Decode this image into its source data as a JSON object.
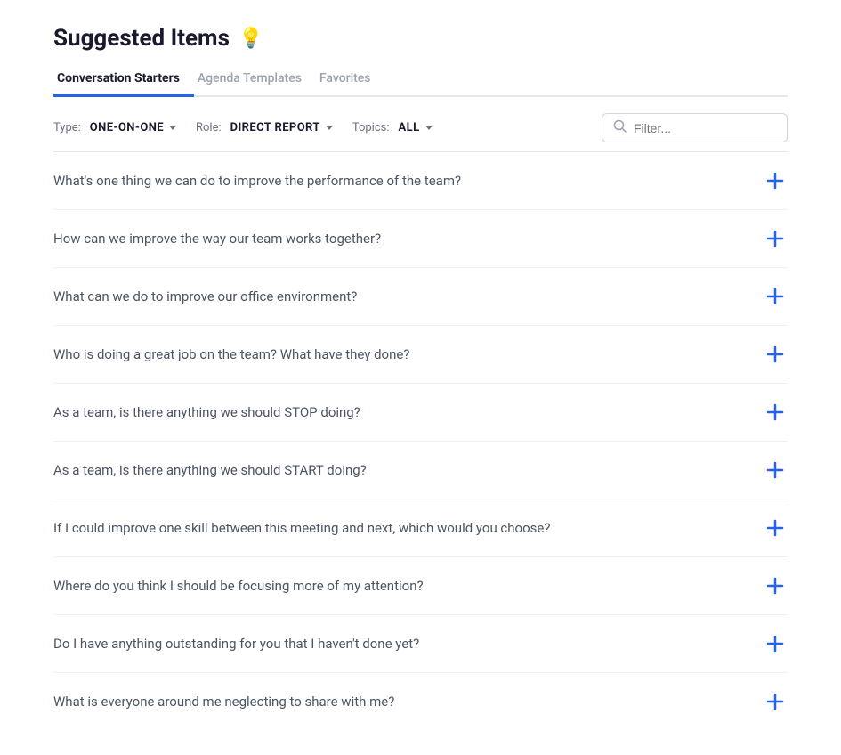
{
  "header": {
    "title": "Suggested Items",
    "icon": "💡"
  },
  "tabs": [
    {
      "id": "conversation-starters",
      "label": "Conversation Starters",
      "active": true
    },
    {
      "id": "agenda-templates",
      "label": "Agenda Templates",
      "active": false
    },
    {
      "id": "favorites",
      "label": "Favorites",
      "active": false
    }
  ],
  "filters": {
    "type_label": "Type:",
    "type_value": "ONE-ON-ONE",
    "role_label": "Role:",
    "role_value": "DIRECT REPORT",
    "topics_label": "Topics:",
    "topics_value": "ALL",
    "search_placeholder": "Filter..."
  },
  "items": [
    {
      "id": 1,
      "text": "What's one thing we can do to improve the performance of the team?"
    },
    {
      "id": 2,
      "text": "How can we improve the way our team works together?"
    },
    {
      "id": 3,
      "text": "What can we do to improve our office environment?"
    },
    {
      "id": 4,
      "text": "Who is doing a great job on the team? What have they done?"
    },
    {
      "id": 5,
      "text": "As a team, is there anything we should STOP doing?"
    },
    {
      "id": 6,
      "text": "As a team, is there anything we should START doing?"
    },
    {
      "id": 7,
      "text": "If I could improve one skill between this meeting and next, which would you choose?"
    },
    {
      "id": 8,
      "text": "Where do you think I should be focusing more of my attention?"
    },
    {
      "id": 9,
      "text": "Do I have anything outstanding for you that I haven't done yet?"
    },
    {
      "id": 10,
      "text": "What is everyone around me neglecting to share with me?"
    }
  ],
  "accent_color": "#2563eb"
}
